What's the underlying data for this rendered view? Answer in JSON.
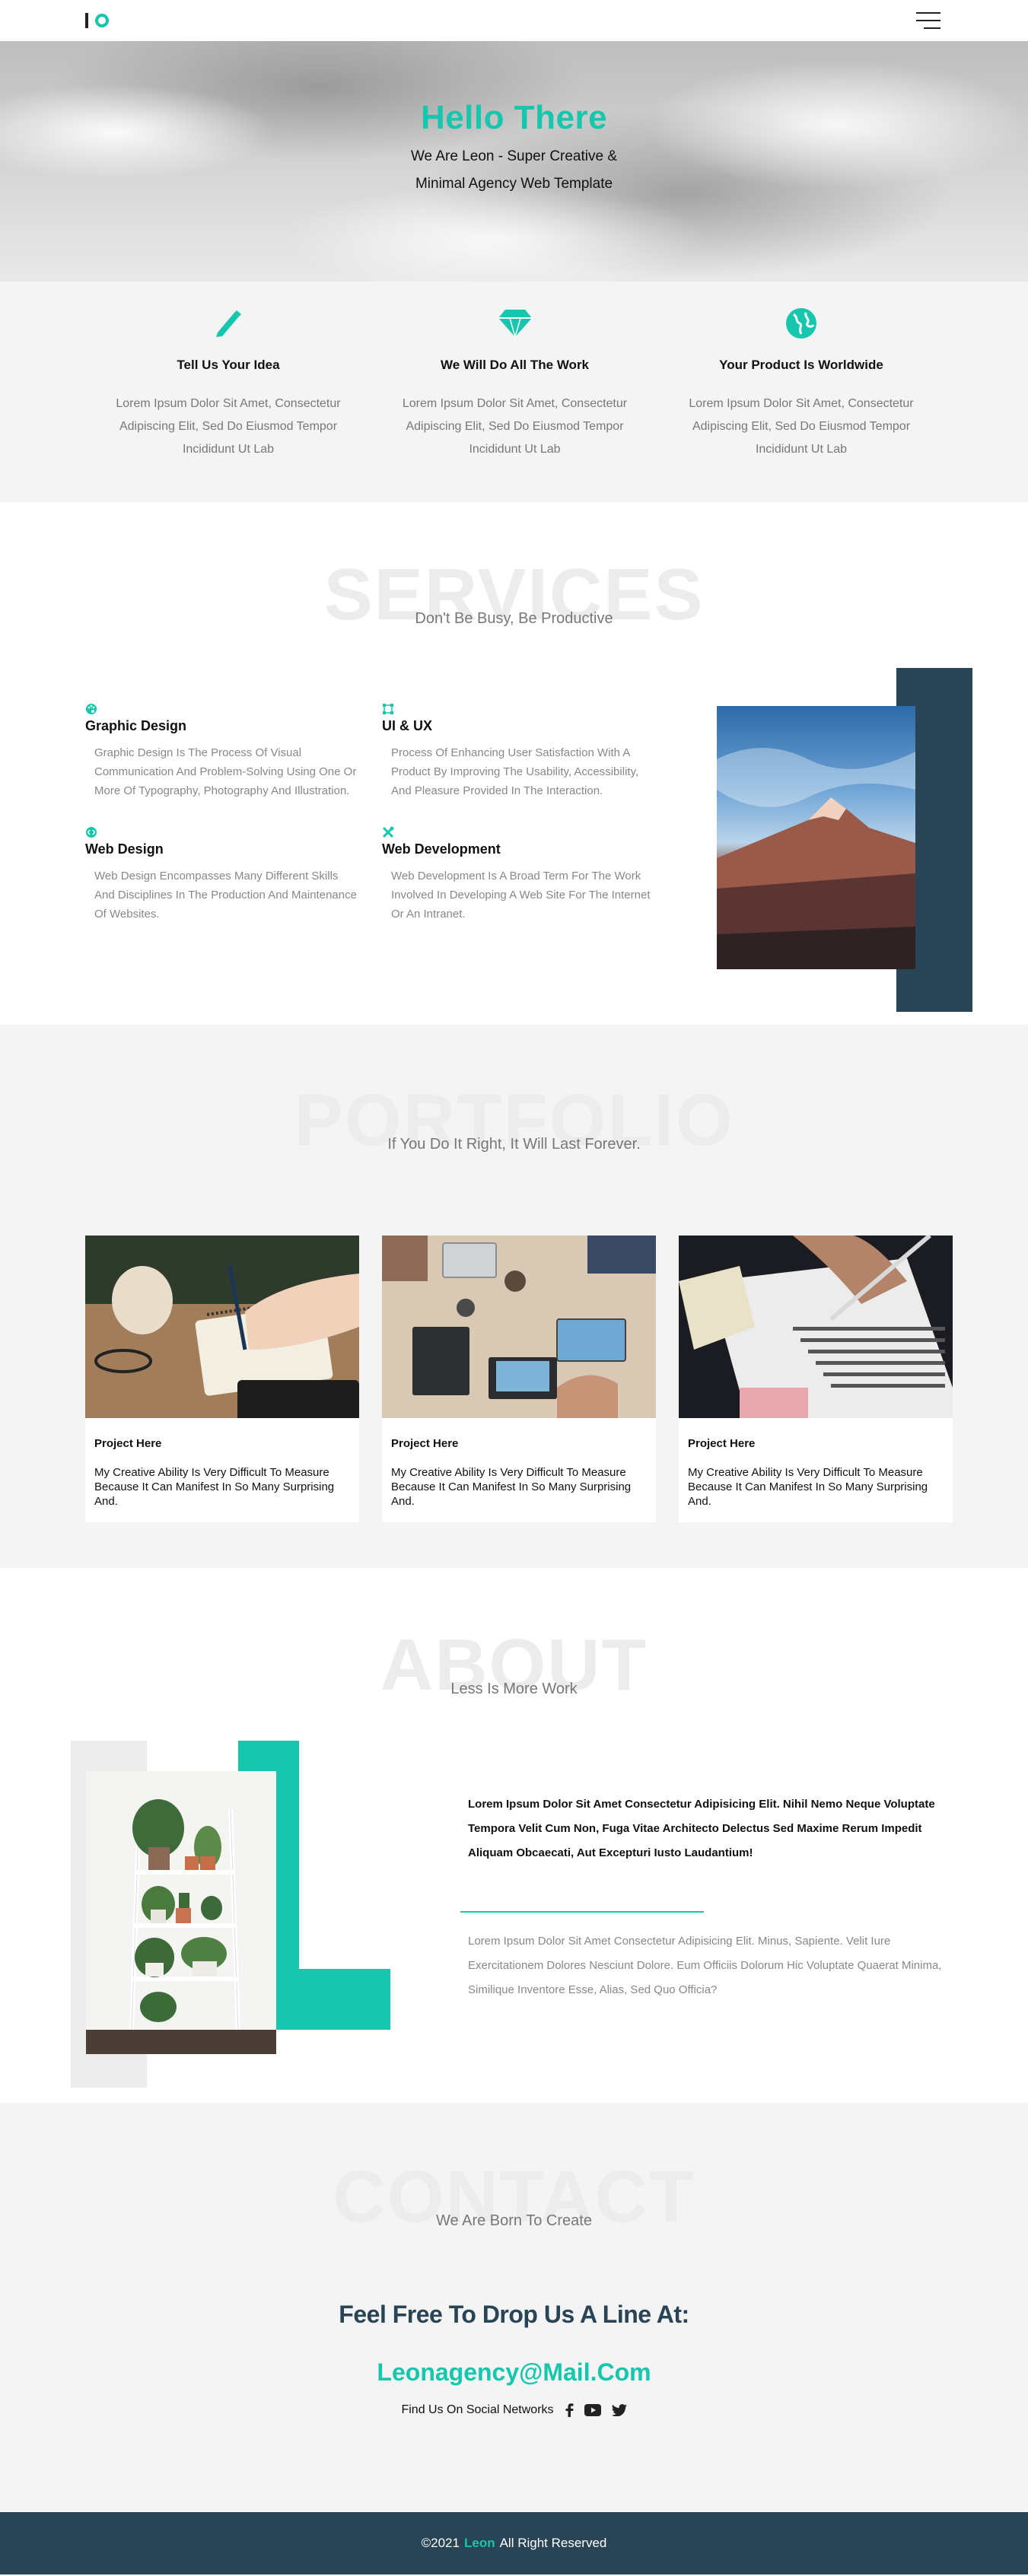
{
  "nav": {
    "menu_icon": "hamburger-menu-icon"
  },
  "hero": {
    "title": "Hello There",
    "subtitle": "We Are Leon - Super Creative & Minimal Agency Web Template"
  },
  "features": [
    {
      "icon": "pencil-icon",
      "title": "Tell Us Your Idea",
      "text": "Lorem Ipsum Dolor Sit Amet, Consectetur Adipiscing Elit, Sed Do Eiusmod Tempor Incididunt Ut Lab"
    },
    {
      "icon": "diamond-icon",
      "title": "We Will Do All The Work",
      "text": "Lorem Ipsum Dolor Sit Amet, Consectetur Adipiscing Elit, Sed Do Eiusmod Tempor Incididunt Ut Lab"
    },
    {
      "icon": "globe-icon",
      "title": "Your Product Is Worldwide",
      "text": "Lorem Ipsum Dolor Sit Amet, Consectetur Adipiscing Elit, Sed Do Eiusmod Tempor Incididunt Ut Lab"
    }
  ],
  "services": {
    "heading": "SERVICES",
    "subheading": "Don't Be Busy, Be Productive",
    "items": [
      {
        "icon": "palette-icon",
        "title": "Graphic Design",
        "text": "Graphic Design Is The Process Of Visual Communication And Problem-Solving Using One Or More Of Typography, Photography And Illustration."
      },
      {
        "icon": "vector-square-icon",
        "title": "UI & UX",
        "text": "Process Of Enhancing User Satisfaction With A Product By Improving The Usability, Accessibility, And Pleasure Provided In The Interaction."
      },
      {
        "icon": "code-icon",
        "title": "Web Design",
        "text": "Web Design Encompasses Many Different Skills And Disciplines In The Production And Maintenance Of Websites."
      },
      {
        "icon": "tools-icon",
        "title": "Web Development",
        "text": "Web Development Is A Broad Term For The Work Involved In Developing A Web Site For The Internet Or An Intranet."
      }
    ]
  },
  "portfolio": {
    "heading": "PORTFOLIO",
    "subheading": "If You Do It Right, It Will Last Forever.",
    "items": [
      {
        "title": "Project Here",
        "text": "My Creative Ability Is Very Difficult To Measure Because It Can Manifest In So Many Surprising And."
      },
      {
        "title": "Project Here",
        "text": "My Creative Ability Is Very Difficult To Measure Because It Can Manifest In So Many Surprising And."
      },
      {
        "title": "Project Here",
        "text": "My Creative Ability Is Very Difficult To Measure Because It Can Manifest In So Many Surprising And."
      }
    ]
  },
  "about": {
    "heading": "ABOUT",
    "subheading": "Less Is More Work",
    "bold_text": "Lorem Ipsum Dolor Sit Amet Consectetur Adipisicing Elit. Nihil Nemo Neque Voluptate Tempora Velit Cum Non, Fuga Vitae Architecto Delectus Sed Maxime Rerum Impedit Aliquam Obcaecati, Aut Excepturi Iusto Laudantium!",
    "light_text": "Lorem Ipsum Dolor Sit Amet Consectetur Adipisicing Elit. Minus, Sapiente. Velit Iure Exercitationem Dolores Nesciunt Dolore. Eum Officiis Dolorum Hic Voluptate Quaerat Minima, Similique Inventore Esse, Alias, Sed Quo Officia?"
  },
  "contact": {
    "heading": "CONTACT",
    "subheading": "We Are Born To Create",
    "tagline": "Feel Free To Drop Us A Line At:",
    "email": "Leonagency@Mail.Com",
    "social_label": "Find Us On Social Networks",
    "social_icons": [
      "facebook-icon",
      "youtube-icon",
      "twitter-icon"
    ]
  },
  "footer": {
    "prefix": "©2021",
    "brand": "Leon",
    "suffix": "All Right Reserved"
  },
  "colors": {
    "accent": "#16c6ad",
    "navy": "#284455",
    "light_bg": "#f4f4f4"
  }
}
